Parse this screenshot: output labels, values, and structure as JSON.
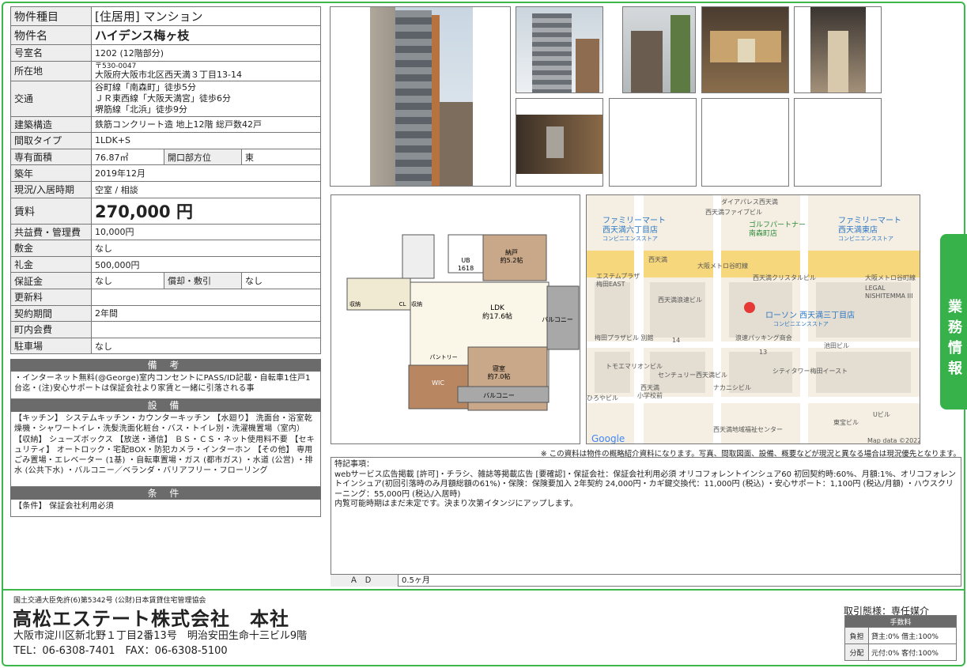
{
  "spec": {
    "rows": [
      {
        "k": "物件種目",
        "v": "[住居用] マンション"
      },
      {
        "k": "物件名",
        "v": "ハイデンス梅ヶ枝"
      },
      {
        "k": "号室名",
        "v": "1202 (12階部分)"
      },
      {
        "k": "所在地",
        "v_small": "〒530-0047",
        "v": "大阪府大阪市北区西天満３丁目13-14"
      },
      {
        "k": "交通",
        "lines": [
          "谷町線「南森町」徒歩5分",
          "ＪＲ東西線「大阪天満宮」徒歩6分",
          "堺筋線「北浜」徒歩9分"
        ]
      },
      {
        "k": "建築構造",
        "v": "鉄筋コンクリート造 地上12階 総戸数42戸"
      },
      {
        "k": "間取タイプ",
        "v": "1LDK+S"
      },
      {
        "k": "専有面積",
        "v": "76.87㎡",
        "k2": "開口部方位",
        "v2": "東"
      },
      {
        "k": "築年",
        "v": "2019年12月"
      },
      {
        "k": "現況/入居時期",
        "v": "空室 / 相談"
      },
      {
        "k": "賃料",
        "v": "270,000 円"
      },
      {
        "k": "共益費・管理費",
        "v": "10,000円"
      },
      {
        "k": "敷金",
        "v": "なし"
      },
      {
        "k": "礼金",
        "v": "500,000円"
      },
      {
        "k": "保証金",
        "v": "なし",
        "k2": "償却・敷引",
        "v2": "なし"
      },
      {
        "k": "更新料",
        "v": ""
      },
      {
        "k": "契約期間",
        "v": "2年間"
      },
      {
        "k": "町内会費",
        "v": ""
      },
      {
        "k": "駐車場",
        "v": "なし"
      }
    ]
  },
  "biko": {
    "title": "備 考",
    "text": "・インターネット無料(@George)室内コンセントにPASS/ID記載・自転車1住戸1台迄・(注)安心サポートは保証会社より家賃と一緒に引落される事"
  },
  "setsubi": {
    "title": "設 備",
    "text": "【キッチン】 システムキッチン・カウンターキッチン 【水廻り】 洗面台・浴室乾燥機・シャワートイレ・洗髪洗面化粧台・バス・トイレ別・洗濯機置場（室内） 【収納】 シューズボックス 【放送・通信】 ＢＳ・ＣＳ・ネット使用料不要 【セキュリティ】 オートロック・宅配BOX・防犯カメラ・インターホン 【その他】 専用ごみ置場・エレベーター (1基) ・自転車置場・ガス (都市ガス) ・水道 (公営) ・排水 (公共下水) ・バルコニー／ベランダ・バリアフリー・フローリング"
  },
  "joken": {
    "title": "条 件",
    "text": "【条件】 保証会社利用必須"
  },
  "plan": {
    "rooms": [
      "納戸\n約5.2帖",
      "UB\n1618",
      "LDK\n約17.6帖",
      "寝室\n約7.0帖",
      "バルコニー",
      "バルコニー",
      "WIC",
      "CL",
      "収納",
      "収納",
      "パントリー"
    ]
  },
  "map": {
    "labels": [
      "ファミリーマート",
      "西天満六丁目店",
      "コンビニエンスストア",
      "ゴルフパートナー",
      "南森町店",
      "ファミリーマート",
      "西天満東店",
      "コンビニエンスストア",
      "ダイアパレス西天満",
      "西天満ファイブビル",
      "大阪メトロ谷町線",
      "西天満",
      "大阪メトロ谷町線",
      "エステムプラザ",
      "梅田EAST",
      "西天満クリスタルビル",
      "LEGAL",
      "NISHITEMMA III",
      "西天満浪速ビル",
      "ローソン 西天満三丁目店",
      "コンビニエンスストア",
      "梅田プラザビル 別館",
      "14",
      "浪速パッキング商会",
      "池田ビル",
      "13",
      "トモエマリオンビル",
      "センチュリー西天満ビル",
      "シティタワー梅田イースト",
      "ナカニシビル",
      "ひろやビル",
      "西天満",
      "小学校前",
      "東宝ビル",
      "Uビル",
      "西天満地域福祉センター",
      "Google",
      "Map data ©2022"
    ]
  },
  "note": "※ この資料は物件の概略紹介資料になります。写真、間取図面、設備、概要などが現況と異なる場合は現況優先となります。",
  "remarks": {
    "lines": [
      "特記事項：",
      "webサービス広告掲載 [許可]・チラシ、雑誌等掲載広告 [要確認]・保証会社：保証会社利用必須 オリコフォレントインシュア60 初回契約時:60%、月額:1%、オリコフォレントインシュア(初回引落時のみ月額総額の61%)・保険：保険要加入 2年契約 24,000円・カギ鍵交換代：11,000円 (税込) ・安心サポート：1,100円 (税込/月額) ・ハウスクリーニング：55,000円 (税込/入居時)",
      "内覧可能時期はまだ未定です。決まり次第イタンジにアップします。"
    ]
  },
  "ad": {
    "k": "ＡＤ",
    "v": "0.5ヶ月"
  },
  "sidetab": "業務情報",
  "footer": {
    "license": "国土交通大臣免許(6)第5342号 (公財)日本賃貸住宅管理協会",
    "company": "高松エステート株式会社　本社",
    "address": "大阪市淀川区新北野１丁目2番13号　明治安田生命十三ビル9階",
    "tel": "TEL：06-6308-7401　FAX：06-6308-5100",
    "torihiki": "取引態様：専任媒介",
    "fee_title": "手数料",
    "fee": [
      {
        "k": "負担",
        "v": "貸主:0% 借主:100%"
      },
      {
        "k": "分配",
        "v": "元付:0% 客付:100%"
      }
    ]
  },
  "colors": {
    "accent": "#3cb84a",
    "header_gray": "#6b6b6b",
    "label_bg": "#eeeeee"
  }
}
